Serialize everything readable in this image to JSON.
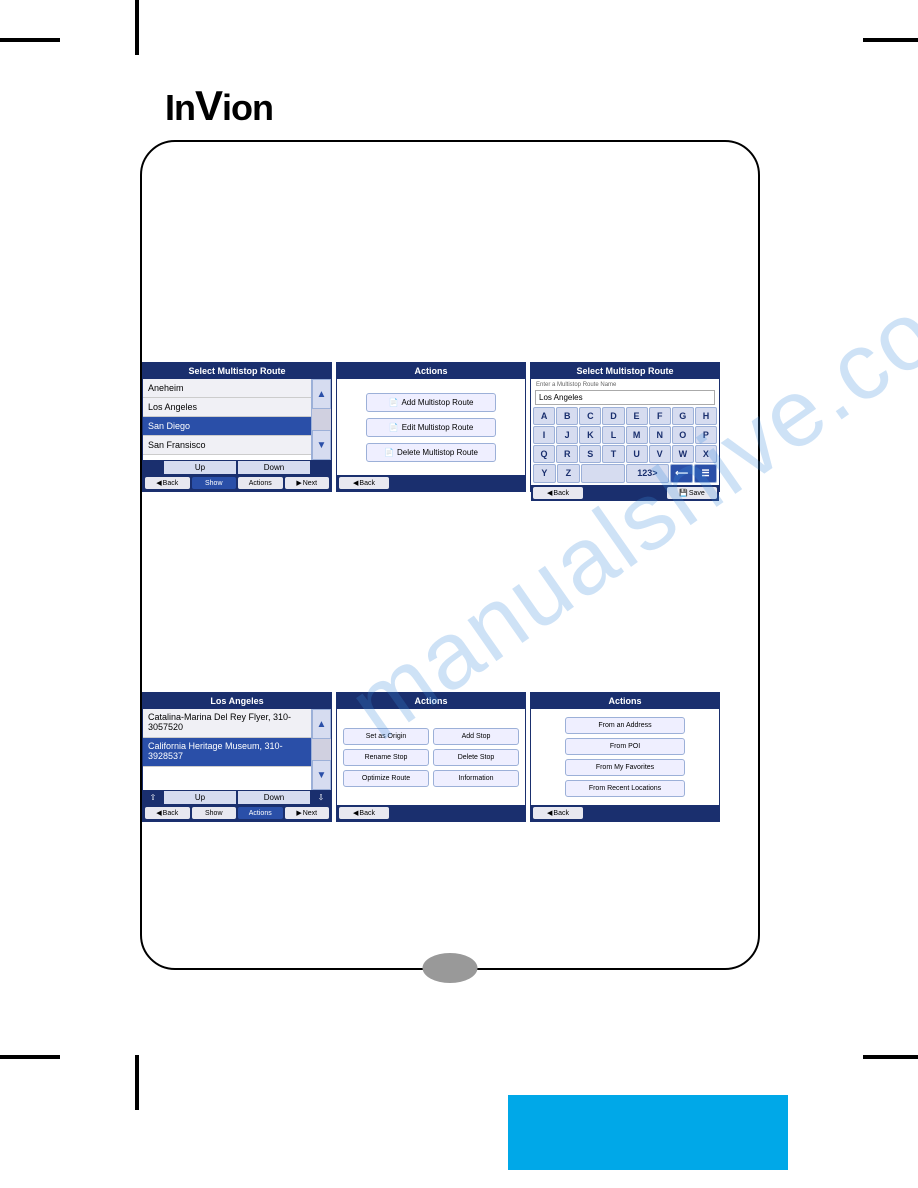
{
  "logo": "InVion",
  "screens": {
    "row1": {
      "s1": {
        "title": "Select Multistop Route",
        "items": [
          "Aneheim",
          "Los Angeles",
          "San Diego",
          "San Fransisco"
        ],
        "selectedIndex": 2,
        "up": "Up",
        "down": "Down",
        "back": "Back",
        "show": "Show",
        "actions": "Actions",
        "next": "Next"
      },
      "s2": {
        "title": "Actions",
        "btns": [
          "Add Multistop Route",
          "Edit Multistop Route",
          "Delete Multistop Route"
        ],
        "back": "Back"
      },
      "s3": {
        "title": "Select Multistop Route",
        "hint": "Enter a Multistop Route Name",
        "input": "Los Angeles",
        "keys": [
          [
            "A",
            "B",
            "C",
            "D",
            "E",
            "F",
            "G",
            "H"
          ],
          [
            "I",
            "J",
            "K",
            "L",
            "M",
            "N",
            "O",
            "P"
          ],
          [
            "Q",
            "R",
            "S",
            "T",
            "U",
            "V",
            "W",
            "X"
          ],
          [
            "Y",
            "Z",
            "",
            "",
            "123>",
            "",
            "⟵",
            ""
          ]
        ],
        "back": "Back",
        "save": "Save"
      }
    },
    "row2": {
      "s4": {
        "title": "Los Angeles",
        "items": [
          "Catalina-Marina Del Rey Flyer, 310-3057520",
          "California Heritage Museum, 310-3928537"
        ],
        "selectedIndex": 1,
        "up": "Up",
        "down": "Down",
        "back": "Back",
        "show": "Show",
        "actions": "Actions",
        "next": "Next"
      },
      "s5": {
        "title": "Actions",
        "btns": [
          "Set as Origin",
          "Add Stop",
          "Rename Stop",
          "Delete Stop",
          "Optimize Route",
          "Information"
        ],
        "back": "Back"
      },
      "s6": {
        "title": "Actions",
        "btns": [
          "From an Address",
          "From POI",
          "From My Favorites",
          "From Recent Locations"
        ],
        "back": "Back"
      }
    }
  },
  "watermark": "manualshive.com"
}
